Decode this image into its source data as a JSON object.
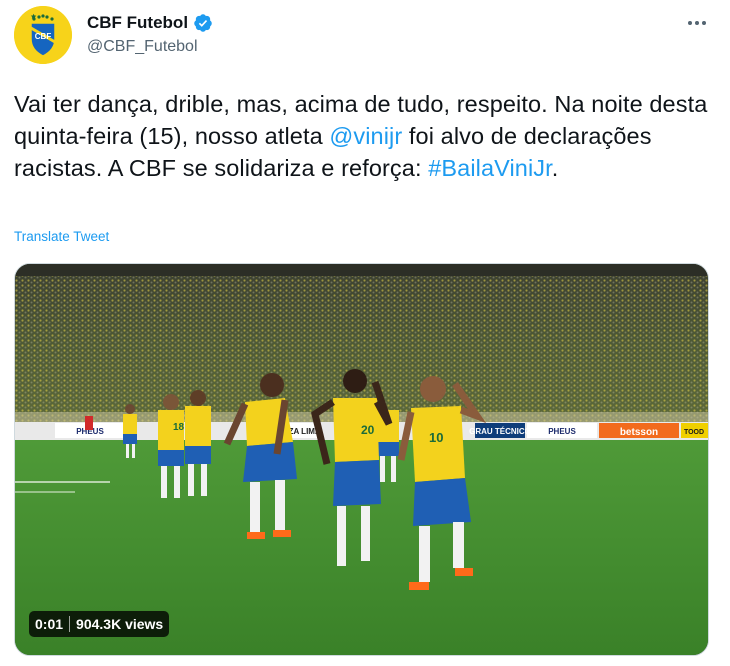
{
  "author": {
    "display_name": "CBF Futebol",
    "handle": "@CBF_Futebol",
    "verified": true,
    "avatar_text": "CBF"
  },
  "menu_icon": "more-horizontal-icon",
  "tweet": {
    "text_parts": [
      {
        "t": "Vai ter dança, drible, mas, acima de tudo, respeito. Na noite desta quinta-feira (15), nosso atleta ",
        "link": false
      },
      {
        "t": "@vinijr",
        "link": true
      },
      {
        "t": " foi alvo de declarações racistas. A CBF se solidariza e reforça: ",
        "link": false
      },
      {
        "t": "#BailaViniJr",
        "link": true
      },
      {
        "t": ".",
        "link": false
      }
    ]
  },
  "translate_label": "Translate Tweet",
  "media": {
    "type": "video",
    "timestamp": "0:01",
    "views": "904.3K views",
    "ad_boards": [
      "PHEUS",
      "SOUZA LIMA",
      "GRAU TÉCNICO",
      "PHEUS",
      "betsson",
      "TOOD"
    ],
    "jersey_numbers": [
      "18",
      "10",
      "20"
    ]
  },
  "colors": {
    "link": "#1d9bf0",
    "secondary": "#536471",
    "avatar_bg": "#f7d31a",
    "pitch": "#3f8a2e"
  }
}
